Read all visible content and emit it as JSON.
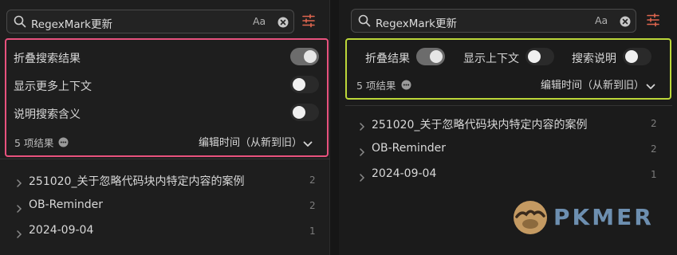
{
  "left": {
    "search": {
      "query": "RegexMark更新",
      "case_label": "Aa"
    },
    "options": [
      {
        "label": "折叠搜索结果",
        "enabled": true
      },
      {
        "label": "显示更多上下文",
        "enabled": false
      },
      {
        "label": "说明搜索含义",
        "enabled": false
      }
    ],
    "result_count": "5 项结果",
    "sort_label": "编辑时间（从新到旧）",
    "results": [
      {
        "title": "251020_关于忽略代码块内特定内容的案例",
        "count": "2"
      },
      {
        "title": "OB-Reminder",
        "count": "2"
      },
      {
        "title": "2024-09-04",
        "count": "1"
      }
    ]
  },
  "right": {
    "search": {
      "query": "RegexMark更新",
      "case_label": "Aa"
    },
    "options": [
      {
        "label": "折叠结果",
        "enabled": true
      },
      {
        "label": "显示上下文",
        "enabled": false
      },
      {
        "label": "搜索说明",
        "enabled": false
      }
    ],
    "result_count": "5 项结果",
    "sort_label": "编辑时间（从新到旧）",
    "results": [
      {
        "title": "251020_关于忽略代码块内特定内容的案例",
        "count": "2"
      },
      {
        "title": "OB-Reminder",
        "count": "2"
      },
      {
        "title": "2024-09-04",
        "count": "1"
      }
    ]
  },
  "watermark": {
    "text": "PKMER"
  },
  "colors": {
    "left_highlight": "#e8527e",
    "right_highlight": "#bcd739",
    "settings_icon": "#e0664f",
    "logo_text": "#6d8fb0"
  }
}
